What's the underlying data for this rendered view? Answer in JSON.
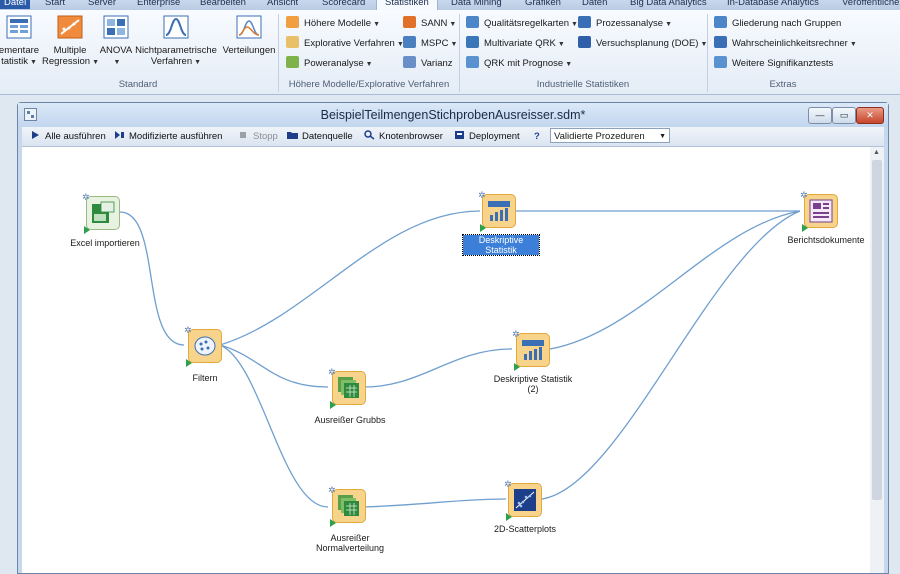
{
  "ribbon_tabs": [
    "Datei",
    "Start",
    "Server",
    "Enterprise",
    "Bearbeiten",
    "Ansicht",
    "Scorecard",
    "Statistiken",
    "Data Mining",
    "Grafiken",
    "Daten",
    "Big Data Analytics",
    "In-Database Analytics",
    "Veröffentliche"
  ],
  "ribbon": {
    "standard": {
      "title": "Standard",
      "elementare_1": "ementare",
      "elementare_2": "tatistik",
      "multiple_1": "Multiple",
      "multiple_2": "Regression",
      "anova": "ANOVA",
      "nichtpar_1": "Nichtparametrische",
      "nichtpar_2": "Verfahren",
      "verteilungen": "Verteilungen"
    },
    "hoehere": {
      "title": "Höhere Modelle/Explorative Verfahren",
      "items": [
        "Höhere Modelle",
        "Explorative Verfahren",
        "Poweranalyse",
        "SANN",
        "MSPC",
        "Varianz"
      ]
    },
    "industrie": {
      "title": "Industrielle Statistiken",
      "items": [
        "Qualitätsregelkarten",
        "Multivariate QRK",
        "QRK mit Prognose",
        "Prozessanalyse",
        "Versuchsplanung (DOE)"
      ]
    },
    "extras": {
      "title": "Extras",
      "items": [
        "Gliederung nach Gruppen",
        "Wahrscheinlichkeitsrechner",
        "Weitere Signifikanztests"
      ]
    }
  },
  "window": {
    "title": "BeispielTeilmengenStichprobenAusreisser.sdm*",
    "btn_min": "—",
    "btn_max": "▭",
    "btn_close": "✕"
  },
  "toolbar": {
    "run_all": "Alle ausführen",
    "run_modified": "Modifizierte ausführen",
    "stop": "Stopp",
    "datasource": "Datenquelle",
    "nodebrowser": "Knotenbrowser",
    "deployment": "Deployment",
    "help": "?",
    "select_value": "Validierte Prozeduren"
  },
  "nodes": {
    "excel": "Excel importieren",
    "filter": "Filtern",
    "deskriptiv1": "Deskriptive Statistik",
    "ausreisser_grubbs": "Ausreißer Grubbs",
    "deskriptiv2_1": "Deskriptive Statistik",
    "deskriptiv2_2": "(2)",
    "ausreisser_nv_1": "Ausreißer",
    "ausreisser_nv_2": "Normalverteilung",
    "scatter": "2D-Scatterplots",
    "bericht": "Berichtsdokumente"
  },
  "colors": {
    "node_fill": "#f7d38c",
    "node_border": "#e2a93b",
    "connection": "#6f9fcf",
    "selection": "#3b7fd8"
  }
}
